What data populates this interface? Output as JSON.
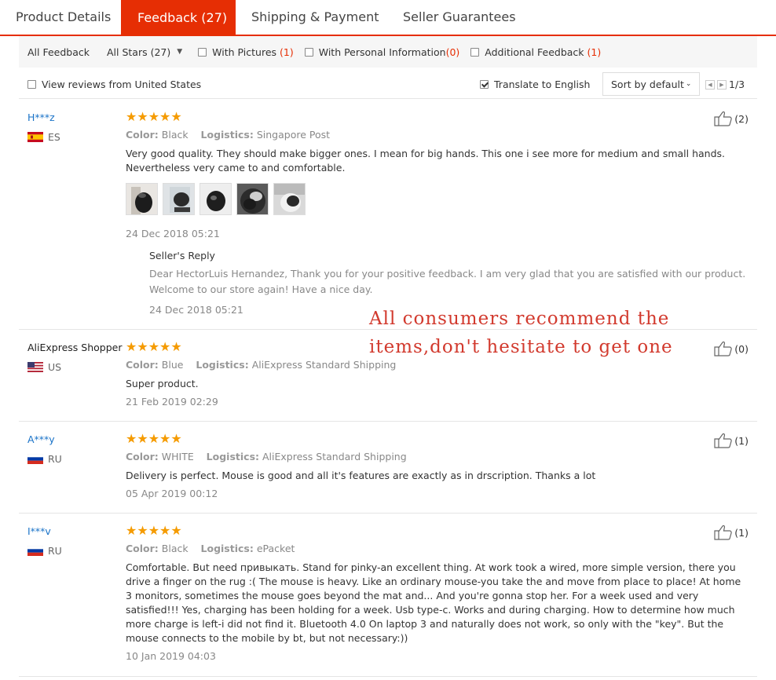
{
  "tabs": [
    {
      "label": "Product Details"
    },
    {
      "label": "Feedback (27)"
    },
    {
      "label": "Shipping & Payment"
    },
    {
      "label": "Seller Guarantees"
    }
  ],
  "filters": {
    "all_feedback": "All Feedback",
    "all_stars": "All Stars (27)",
    "with_pictures": "With Pictures",
    "with_pictures_count": "(1)",
    "with_personal_info": "With Personal Information",
    "with_personal_info_count": "(0)",
    "additional_feedback": "Additional Feedback",
    "additional_feedback_count": "(1)"
  },
  "options": {
    "view_us": "View reviews from United States",
    "translate": "Translate to English",
    "translate_checked": true,
    "sort": "Sort by default",
    "page": "1/3"
  },
  "reviews": [
    {
      "user": "H***z",
      "country": "ES",
      "stars": "★★★★★",
      "color_label": "Color:",
      "color": "Black",
      "logistics_label": "Logistics:",
      "logistics": "Singapore Post",
      "text": "Very good quality. They should make bigger ones. I mean for big hands. This one i see more for medium and small hands. Nevertheless very came to and comfortable.",
      "date": "24 Dec 2018 05:21",
      "likes": "(2)",
      "reply_title": "Seller's Reply",
      "reply_text": "Dear HectorLuis Hernandez, Thank you for your positive feedback. I am very glad that you are satisfied with our product. Welcome to our store again! Have a nice day.",
      "reply_date": "24 Dec 2018 05:21"
    },
    {
      "user": "AliExpress Shopper",
      "country": "US",
      "stars": "★★★★★",
      "color_label": "Color:",
      "color": "Blue",
      "logistics_label": "Logistics:",
      "logistics": "AliExpress Standard Shipping",
      "text": "Super product.",
      "date": "21 Feb 2019 02:29",
      "likes": "(0)"
    },
    {
      "user": "A***y",
      "country": "RU",
      "stars": "★★★★★",
      "color_label": "Color:",
      "color": "WHITE",
      "logistics_label": "Logistics:",
      "logistics": "AliExpress Standard Shipping",
      "text": "Delivery is perfect. Mouse is good and all it's features are exactly as in drscription. Thanks a lot",
      "date": "05 Apr 2019 00:12",
      "likes": "(1)"
    },
    {
      "user": "I***v",
      "country": "RU",
      "stars": "★★★★★",
      "color_label": "Color:",
      "color": "Black",
      "logistics_label": "Logistics:",
      "logistics": "ePacket",
      "text": "Comfortable. But need привыкать. Stand for pinky-an excellent thing. At work took a wired, more simple version, there you drive a finger on the rug :( The mouse is heavy. Like an ordinary mouse-you take the and move from place to place! At home 3 monitors, sometimes the mouse goes beyond the mat and... And you're gonna stop her. For a week used and very satisfied!!! Yes, charging has been holding for a week. Usb type-c. Works and during charging. How to determine how much more charge is left-i did not find it. Bluetooth 4.0 On laptop 3 and naturally does not work, so only with the \"key\". But the mouse connects to the mobile by bt, but not necessary:))",
      "date": "10 Jan 2019 04:03",
      "likes": "(1)"
    }
  ],
  "overlay": {
    "line1": "All consumers recommend the",
    "line2": "items,don't hesitate to get one"
  },
  "colors": {
    "accent": "#e62e04",
    "star": "#f59b00",
    "username": "#1a73c8",
    "overlay_text": "#d23a2e"
  }
}
